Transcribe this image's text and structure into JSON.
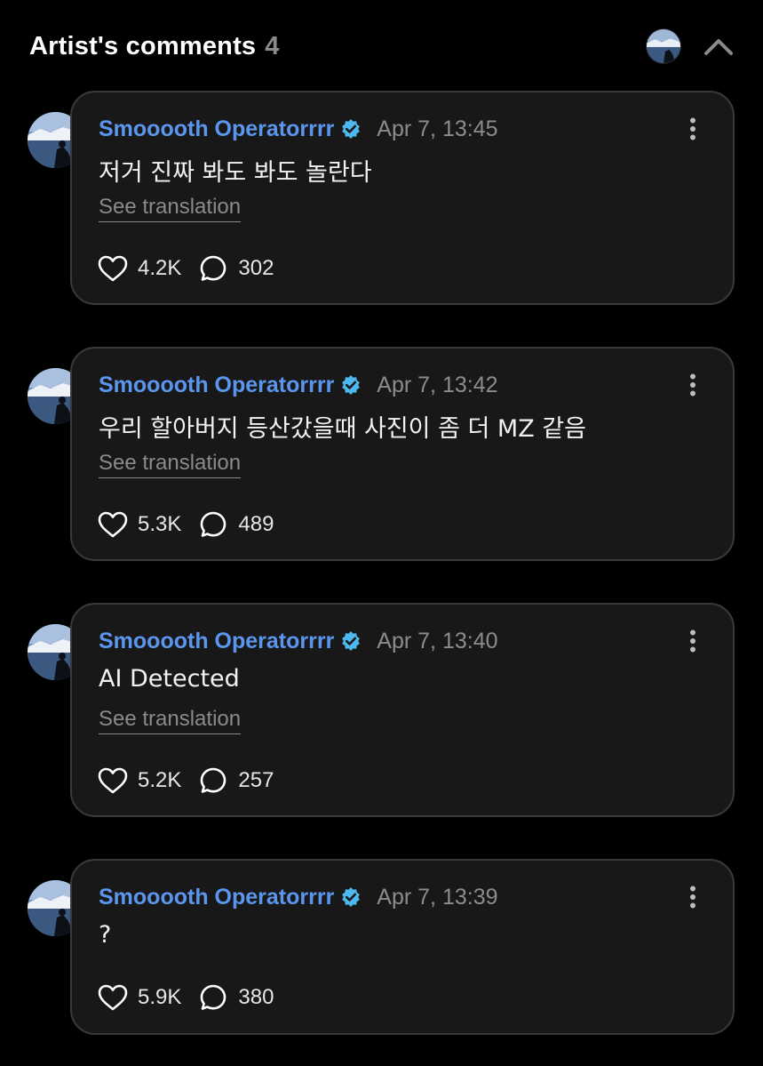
{
  "header": {
    "title": "Artist's comments",
    "count": "4",
    "avatar_icon": "artist-avatar",
    "collapse_icon": "chevron-up-icon"
  },
  "colors": {
    "background": "#000000",
    "card": "#181818",
    "card_border": "#3a3a3a",
    "username": "#5b96ee",
    "verified": "#4fb8f0",
    "muted": "#8c8c8c"
  },
  "comments": [
    {
      "username": "Smooooth Operatorrrr",
      "timestamp": "Apr 7, 13:45",
      "text": "저거 진짜 봐도 봐도 놀란다",
      "translate": "See translation",
      "likes": "4.2K",
      "replies": "302"
    },
    {
      "username": "Smooooth Operatorrrr",
      "timestamp": "Apr 7, 13:42",
      "text": "우리 할아버지 등산갔을때 사진이 좀 더 MZ 같음",
      "translate": "See translation",
      "likes": "5.3K",
      "replies": "489"
    },
    {
      "username": "Smooooth Operatorrrr",
      "timestamp": "Apr 7, 13:40",
      "text": "AI Detected",
      "translate": "See translation",
      "likes": "5.2K",
      "replies": "257"
    },
    {
      "username": "Smooooth Operatorrrr",
      "timestamp": "Apr 7, 13:39",
      "text": "?",
      "likes": "5.9K",
      "replies": "380"
    }
  ]
}
